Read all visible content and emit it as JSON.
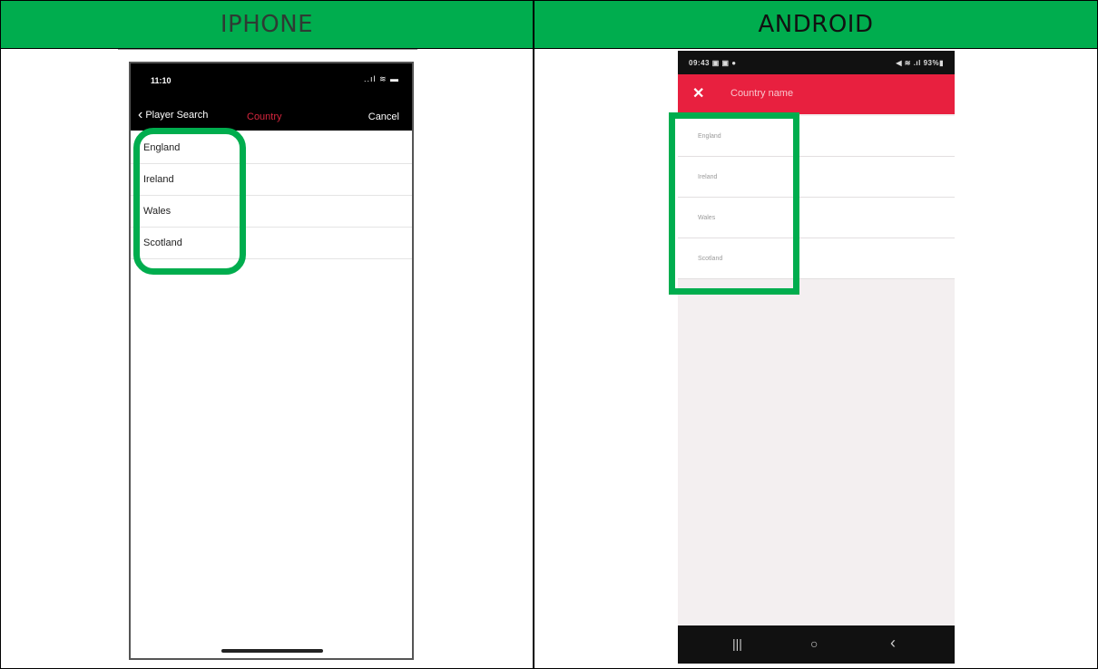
{
  "headers": {
    "iphone": "IPHONE",
    "android": "ANDROID"
  },
  "iphone": {
    "status_time": "11:10",
    "status_icons": "..ıl ≋ ▬",
    "back_label": "Player Search",
    "back_icon": "chevron-left-icon",
    "title": "Country",
    "cancel_label": "Cancel",
    "countries": [
      "England",
      "Ireland",
      "Wales",
      "Scotland"
    ]
  },
  "android": {
    "status_time": "09:43",
    "status_left_icons": "▣ ▣ ●",
    "status_right_icons": "◀ ≋ .ıl 93%▮",
    "close_icon": "close-icon",
    "search_placeholder": "Country name",
    "countries": [
      "England",
      "Ireland",
      "Wales",
      "Scotland"
    ],
    "nav": {
      "recents": "|||",
      "home": "○",
      "back": "‹"
    }
  },
  "colors": {
    "highlight": "#00ad4e",
    "android_toolbar": "#e8203f",
    "iphone_title": "#d7263d"
  }
}
